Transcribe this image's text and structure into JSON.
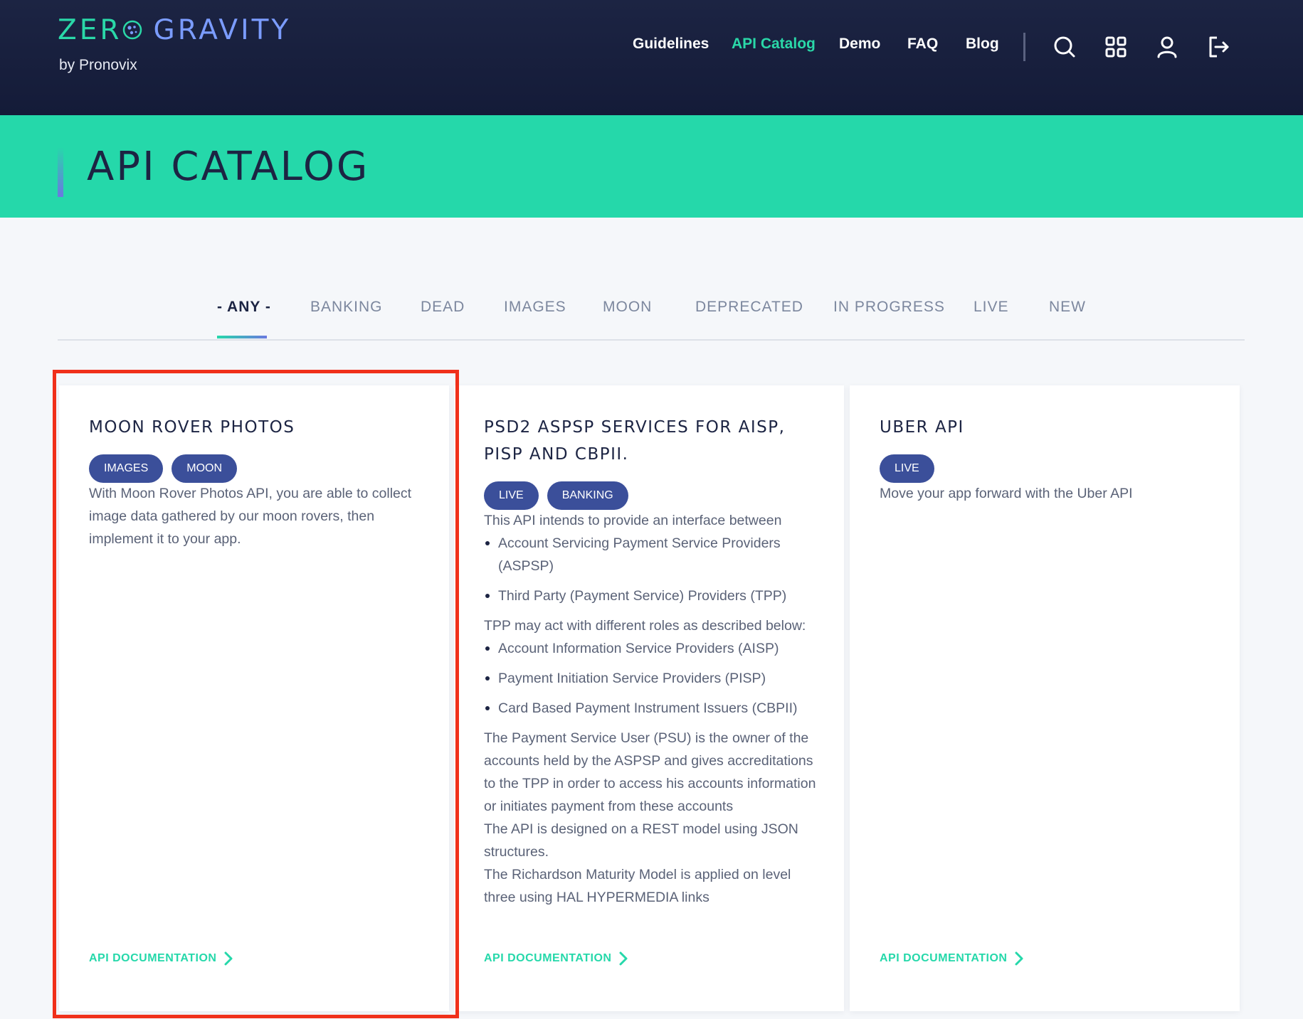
{
  "brand": {
    "title_part1": "ZER",
    "title_part2": "GRAVITY",
    "subtitle": "by Pronovix"
  },
  "nav": {
    "items": [
      {
        "label": "Guidelines",
        "active": false
      },
      {
        "label": "API Catalog",
        "active": true
      },
      {
        "label": "Demo",
        "active": false
      },
      {
        "label": "FAQ",
        "active": false
      },
      {
        "label": "Blog",
        "active": false
      }
    ],
    "icons": [
      "search-icon",
      "grid-icon",
      "user-icon",
      "logout-icon"
    ]
  },
  "banner": {
    "title": "API CATALOG"
  },
  "filters": {
    "tabs": [
      "- ANY -",
      "BANKING",
      "DEAD",
      "IMAGES",
      "MOON",
      "DEPRECATED",
      "IN PROGRESS",
      "LIVE",
      "NEW"
    ],
    "active_index": 0
  },
  "cards": [
    {
      "title": "MOON ROVER PHOTOS",
      "badges": [
        "IMAGES",
        "MOON"
      ],
      "description": "With Moon Rover Photos API, you are able to collect image data gathered by our moon rovers, then implement it to your app.",
      "link": "API DOCUMENTATION"
    },
    {
      "title": "PSD2 ASPSP SERVICES FOR AISP, PISP AND CBPII.",
      "badges": [
        "LIVE",
        "BANKING"
      ],
      "intro": "This API intends to provide an interface between",
      "list1": [
        "Account Servicing Payment Service Providers (ASPSP)",
        "Third Party (Payment Service) Providers (TPP)"
      ],
      "middle": "TPP may act with different roles as described below:",
      "list2": [
        "Account Information Service Providers (AISP)",
        "Payment Initiation Service Providers (PISP)",
        "Card Based Payment Instrument Issuers (CBPII)"
      ],
      "para1": "The Payment Service User (PSU) is the owner of the accounts held by the ASPSP and gives accreditations to the TPP in order to access his accounts information or initiates payment from these accounts",
      "para2": "The API is designed on a REST model using JSON structures.",
      "para3": "The Richardson Maturity Model is applied on level three using HAL HYPERMEDIA links",
      "link": "API DOCUMENTATION"
    },
    {
      "title": "UBER API",
      "badges": [
        "LIVE"
      ],
      "description": "Move your app forward with the Uber API",
      "link": "API DOCUMENTATION"
    }
  ],
  "colors": {
    "header_bg": "#1c2443",
    "accent_green": "#25d8aa",
    "badge_blue": "#3b4f9a",
    "highlight_red": "#f0301a"
  }
}
